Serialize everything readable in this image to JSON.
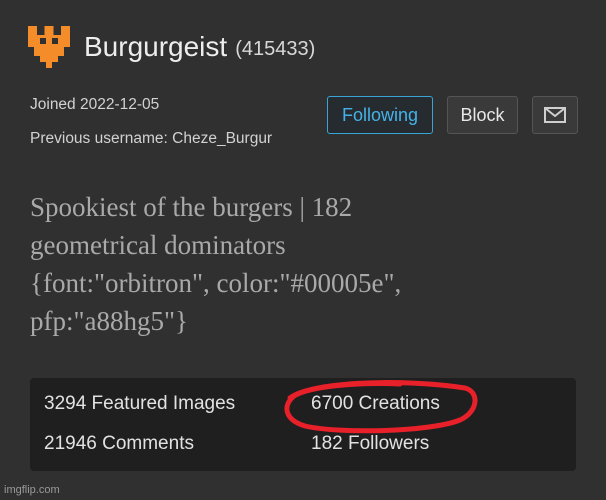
{
  "profile": {
    "username": "Burgurgeist",
    "user_id": "(415433)",
    "joined": "Joined 2022-12-05",
    "previous_username": "Previous username: Cheze_Burgur",
    "avatar_icon": "pixel-castle-icon",
    "avatar_color": "#f58c2a"
  },
  "actions": {
    "following_label": "Following",
    "block_label": "Block",
    "message_icon": "envelope-icon",
    "accent_color": "#44b2e8"
  },
  "bio": {
    "line1": "Spookiest of the burgers | 182",
    "line2": "geometrical dominators",
    "line3": "{font:\"orbitron\", color:\"#00005e\",",
    "line4": "pfp:\"a88hg5\"}"
  },
  "stats": {
    "featured_images": "3294 Featured Images",
    "creations": "6700 Creations",
    "comments": "21946 Comments",
    "followers": "182 Followers",
    "highlight_color": "#e8202a"
  },
  "watermark": "imgflip.com"
}
